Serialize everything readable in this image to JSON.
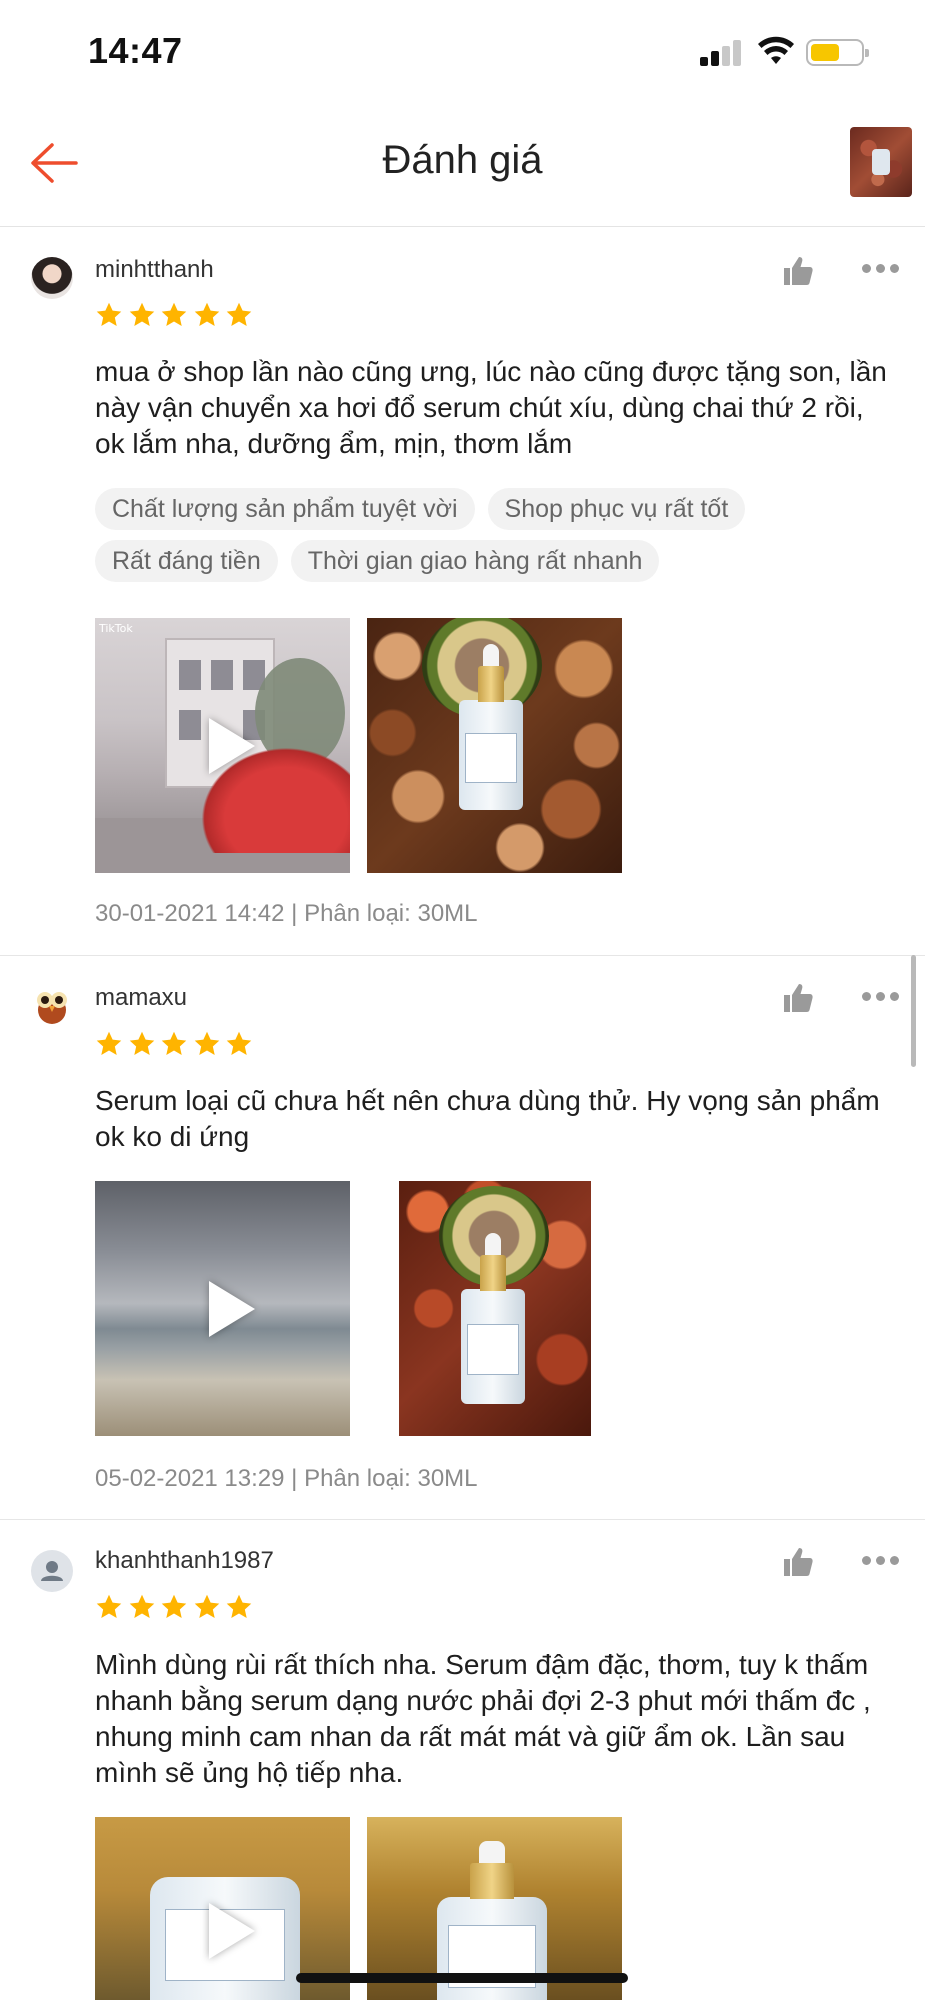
{
  "status_bar": {
    "time": "14:47"
  },
  "header": {
    "title": "Đánh giá"
  },
  "reviews": [
    {
      "username": "minhtthanh",
      "rating": 5,
      "comment": "mua ở shop lần nào cũng ưng, lúc nào cũng được tặng son, lần này vận chuyển xa hơi đổ serum chút xíu, dùng chai thứ 2 rồi, ok lắm nha, dưỡng ẩm, mịn, thơm lắm",
      "tags": [
        "Chất lượng sản phẩm tuyệt vời",
        "Shop phục vụ rất tốt",
        "Rất đáng tiền",
        "Thời gian giao hàng rất nhanh"
      ],
      "meta": "30-01-2021 14:42 | Phân loại: 30ML",
      "video_watermark": "TikTok"
    },
    {
      "username": "mamaxu",
      "rating": 5,
      "comment": "Serum loại cũ chưa hết nên chưa dùng thử. Hy vọng sản phẩm ok ko di ứng",
      "tags": [],
      "meta": "05-02-2021 13:29 | Phân loại: 30ML"
    },
    {
      "username": "khanhthanh1987",
      "rating": 5,
      "comment": "Mình dùng rùi rất thích nha. Serum đậm đặc, thơm, tuy k thấm nhanh bằng serum dạng nước phải đợi 2-3 phut mới thấm đc , nhung minh cam nhan da rất mát mát và giữ ẩm ok. Lần sau mình sẽ ủng hộ tiếp nha."
    }
  ],
  "colors": {
    "back_arrow": "#ee4d2d",
    "star": "#ffb400",
    "icon_gray": "#9a9a9a"
  }
}
